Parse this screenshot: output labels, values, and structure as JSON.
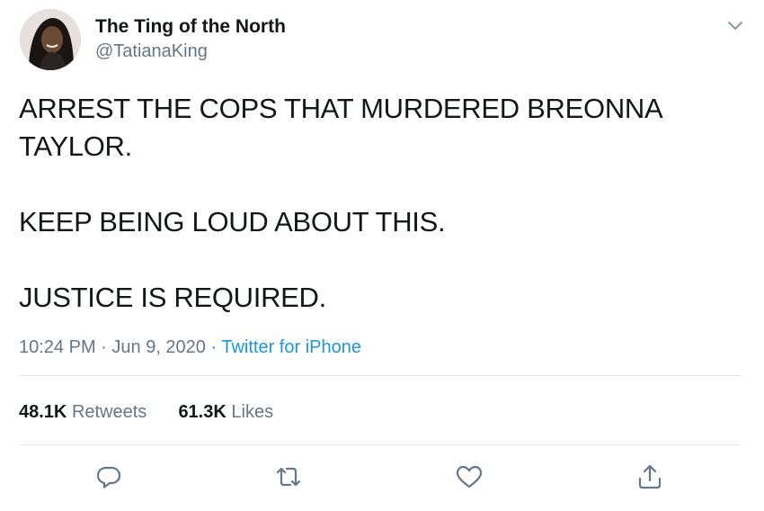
{
  "user": {
    "display_name": "The Ting of the North",
    "handle": "@TatianaKing",
    "avatar": "profile-photo"
  },
  "tweet": {
    "lines": [
      "ARREST THE COPS THAT MURDERED BREONNA TAYLOR.",
      "KEEP BEING LOUD ABOUT THIS.",
      "JUSTICE IS REQUIRED."
    ]
  },
  "meta": {
    "time": "10:24 PM",
    "separator": " · ",
    "date": "Jun 9, 2020",
    "source": "Twitter for iPhone"
  },
  "stats": {
    "retweets_count": "48.1K",
    "retweets_label": "Retweets",
    "likes_count": "61.3K",
    "likes_label": "Likes"
  },
  "actions": {
    "reply_icon": "reply-icon",
    "retweet_icon": "retweet-icon",
    "like_icon": "heart-icon",
    "share_icon": "share-icon"
  },
  "colors": {
    "text": "#14171a",
    "secondary": "#657786",
    "link": "#1b95e0",
    "divider": "#e1e8ed"
  }
}
